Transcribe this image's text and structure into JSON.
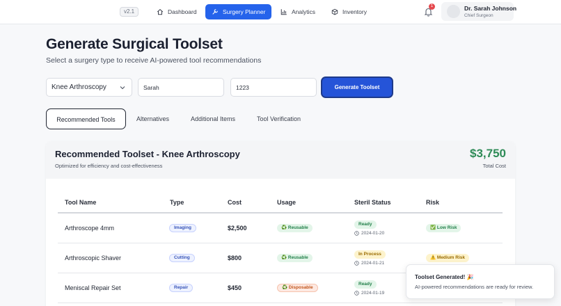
{
  "nav": {
    "version": "v2.1",
    "items": [
      {
        "label": "Dashboard",
        "icon": "home-icon"
      },
      {
        "label": "Surgery Planner",
        "icon": "wrench-icon",
        "active": true
      },
      {
        "label": "Analytics",
        "icon": "bar-chart-icon"
      },
      {
        "label": "Inventory",
        "icon": "box-icon"
      }
    ],
    "notification_count": "1",
    "user": {
      "name": "Dr. Sarah Johnson",
      "role": "Chief Surgeon"
    }
  },
  "header": {
    "title": "Generate Surgical Toolset",
    "subtitle": "Select a surgery type to receive AI-powered tool recommendations"
  },
  "form": {
    "surgery_type": "Knee Arthroscopy",
    "surgeon_value": "Sarah",
    "patient_value": "1223",
    "generate_label": "Generate Toolset"
  },
  "tabs": [
    "Recommended Tools",
    "Alternatives",
    "Additional Items",
    "Tool Verification"
  ],
  "toolset": {
    "title": "Recommended Toolset - Knee Arthroscopy",
    "subtitle": "Optimized for efficiency and cost-effectiveness",
    "total_cost": "$3,750",
    "total_label": "Total Cost",
    "columns": [
      "Tool Name",
      "Type",
      "Cost",
      "Usage",
      "Steril Status",
      "Risk"
    ],
    "rows": [
      {
        "name": "Arthroscope 4mm",
        "type": "Imaging",
        "cost": "$2,500",
        "usage": "♻️ Reusable",
        "status": "Ready",
        "date": "2024-01-20",
        "risk": "✅ Low Risk"
      },
      {
        "name": "Arthroscopic Shaver",
        "type": "Cutting",
        "cost": "$800",
        "usage": "♻️ Reusable",
        "status": "In Process",
        "date": "2024-01-21",
        "risk": "⚠️ Medium Risk"
      },
      {
        "name": "Meniscal Repair Set",
        "type": "Repair",
        "cost": "$450",
        "usage": "♻️ Disposable",
        "status": "Ready",
        "date": "2024-01-19",
        "risk": ""
      }
    ]
  },
  "toast": {
    "title": "Toolset Generated! 🎉",
    "body": "AI-powered recommendations are ready for review."
  },
  "colors": {
    "primary": "#2563eb",
    "success": "#2e8b57",
    "warning": "#9a6b00",
    "danger": "#e5484d"
  }
}
